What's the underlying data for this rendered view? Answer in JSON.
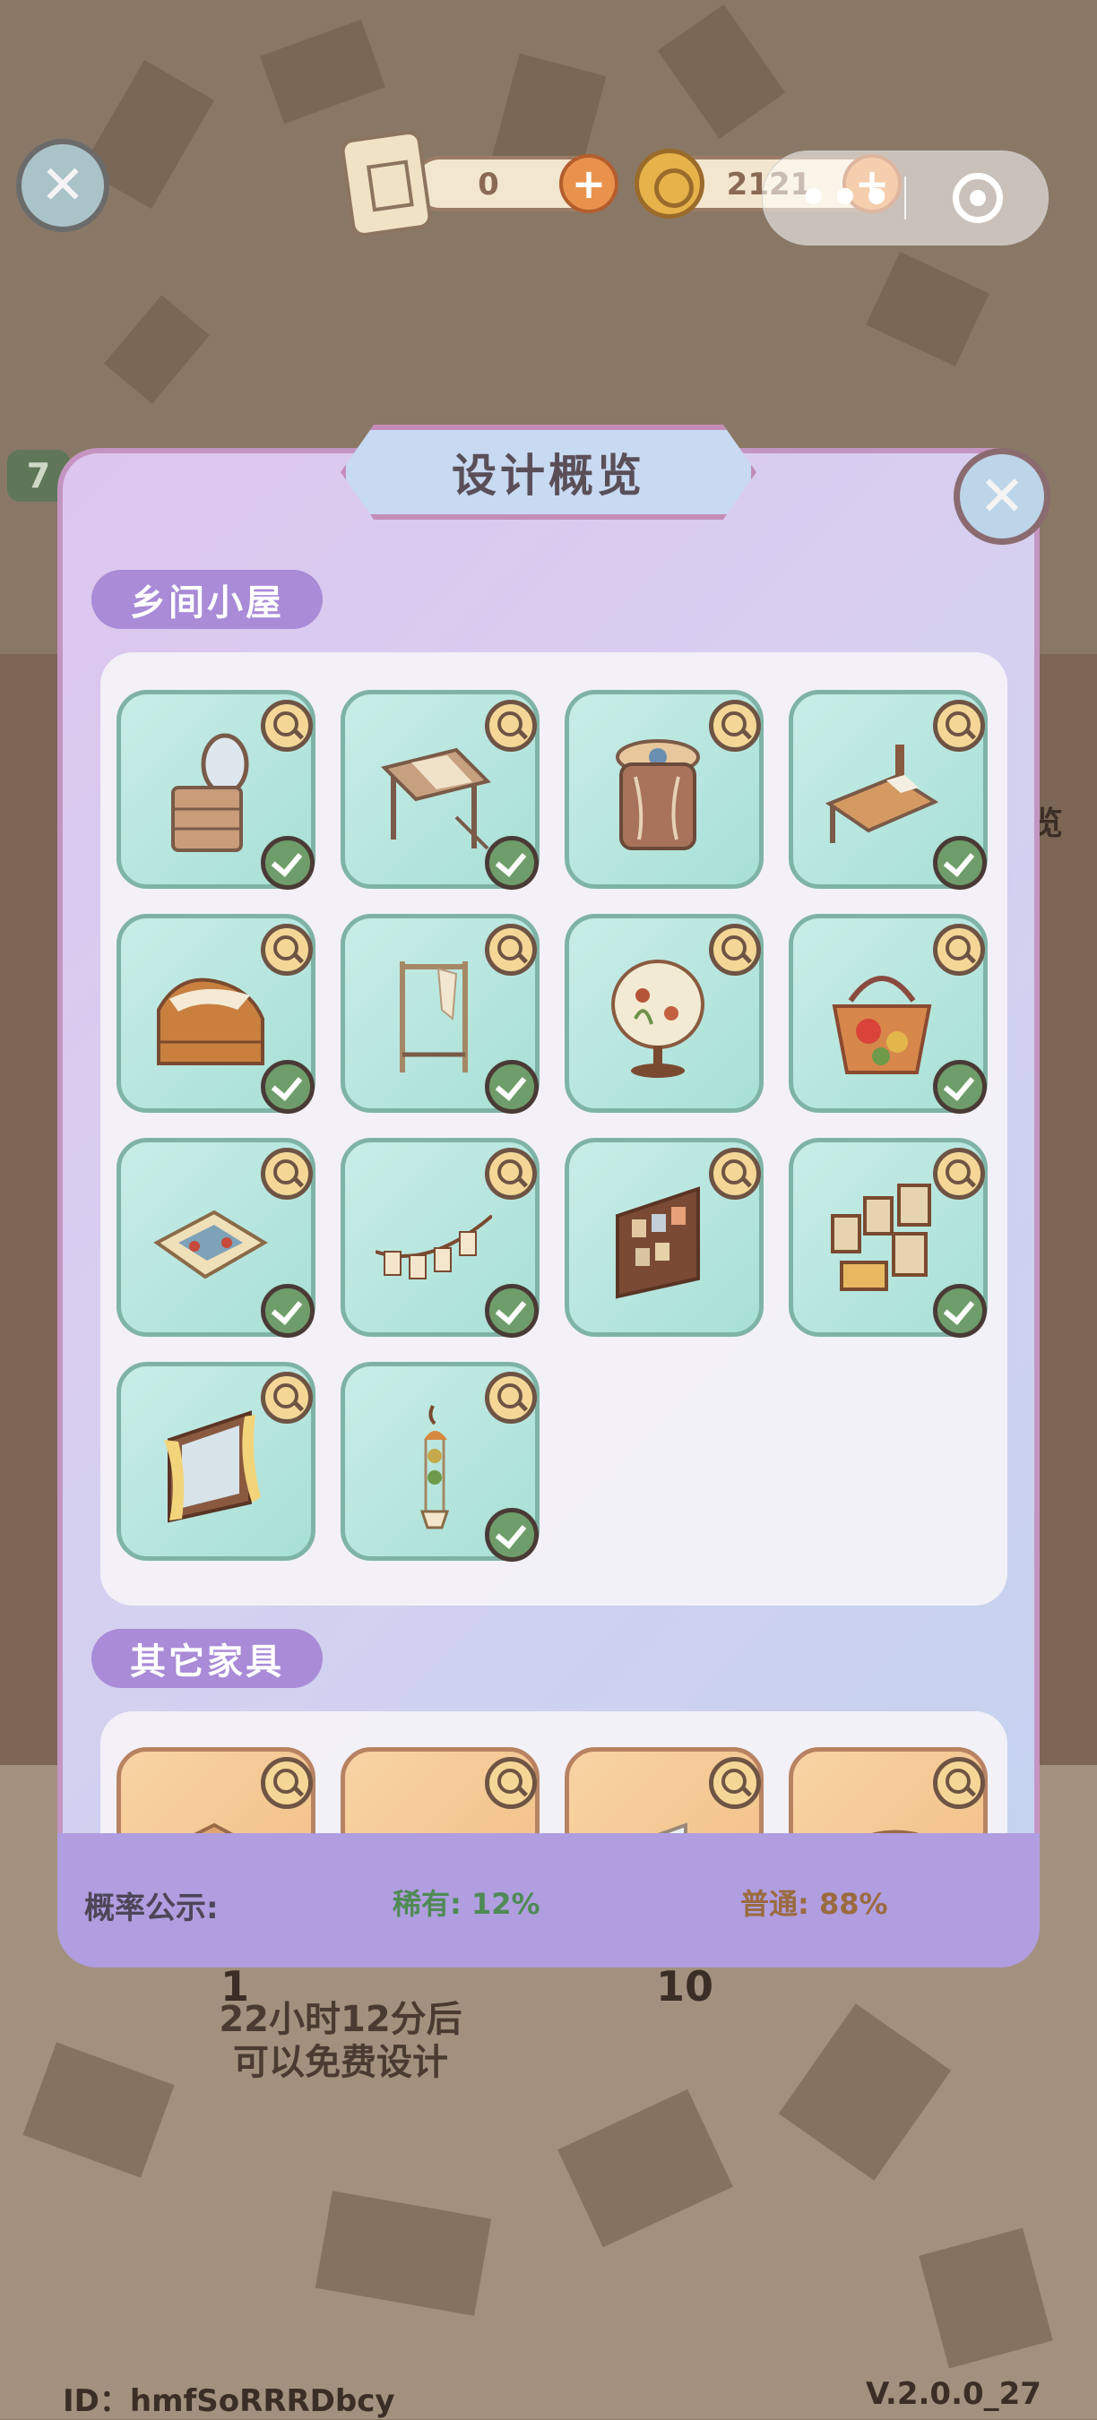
{
  "currency": {
    "scrolls": "0",
    "coins": "2121"
  },
  "mini_program": {
    "more": "•••"
  },
  "dialog": {
    "title": "设计概览",
    "sections": [
      {
        "name": "乡间小屋",
        "items": [
          {
            "icon": "vanity-dresser-icon",
            "collected": true
          },
          {
            "icon": "lace-desk-icon",
            "collected": true
          },
          {
            "icon": "round-stool-icon",
            "collected": true
          },
          {
            "icon": "quilted-bed-icon",
            "collected": true
          },
          {
            "icon": "draped-sofa-icon",
            "collected": true
          },
          {
            "icon": "clothes-rack-icon",
            "collected": true
          },
          {
            "icon": "floral-lamp-icon",
            "collected": true
          },
          {
            "icon": "flower-basket-icon",
            "collected": true
          },
          {
            "icon": "floral-rug-icon",
            "collected": true
          },
          {
            "icon": "bunting-garland-icon",
            "collected": true
          },
          {
            "icon": "card-display-icon",
            "collected": true
          },
          {
            "icon": "wall-frames-icon",
            "collected": true
          },
          {
            "icon": "curtained-window-icon",
            "collected": true
          },
          {
            "icon": "hanging-plant-icon",
            "collected": true
          }
        ]
      },
      {
        "name": "其它家具",
        "items": [
          {
            "icon": "table-icon"
          },
          {
            "icon": "cabinet-icon"
          },
          {
            "icon": "mirror-icon"
          },
          {
            "icon": "panel-icon"
          }
        ]
      }
    ],
    "probability": {
      "label": "概率公示:",
      "rare": "稀有: 12%",
      "common": "普通: 88%"
    }
  },
  "background": {
    "free_design_line1": "22小时12分后",
    "free_design_line2": "可以免费设计",
    "btn_num_1": "1",
    "btn_num_10": "10",
    "left_tag": "7",
    "right_text": "览"
  },
  "footer": {
    "id": "ID：hmfSoRRRDbcy",
    "version": "V.2.0.0_27"
  },
  "colors": {
    "dialog_border": "#c495c2",
    "section_tag": "#a98bd7",
    "tile_teal": "#a8e0d6",
    "check_green": "#6f9d69",
    "rare_text": "#4f8a55",
    "common_text": "#9a6b3f"
  }
}
